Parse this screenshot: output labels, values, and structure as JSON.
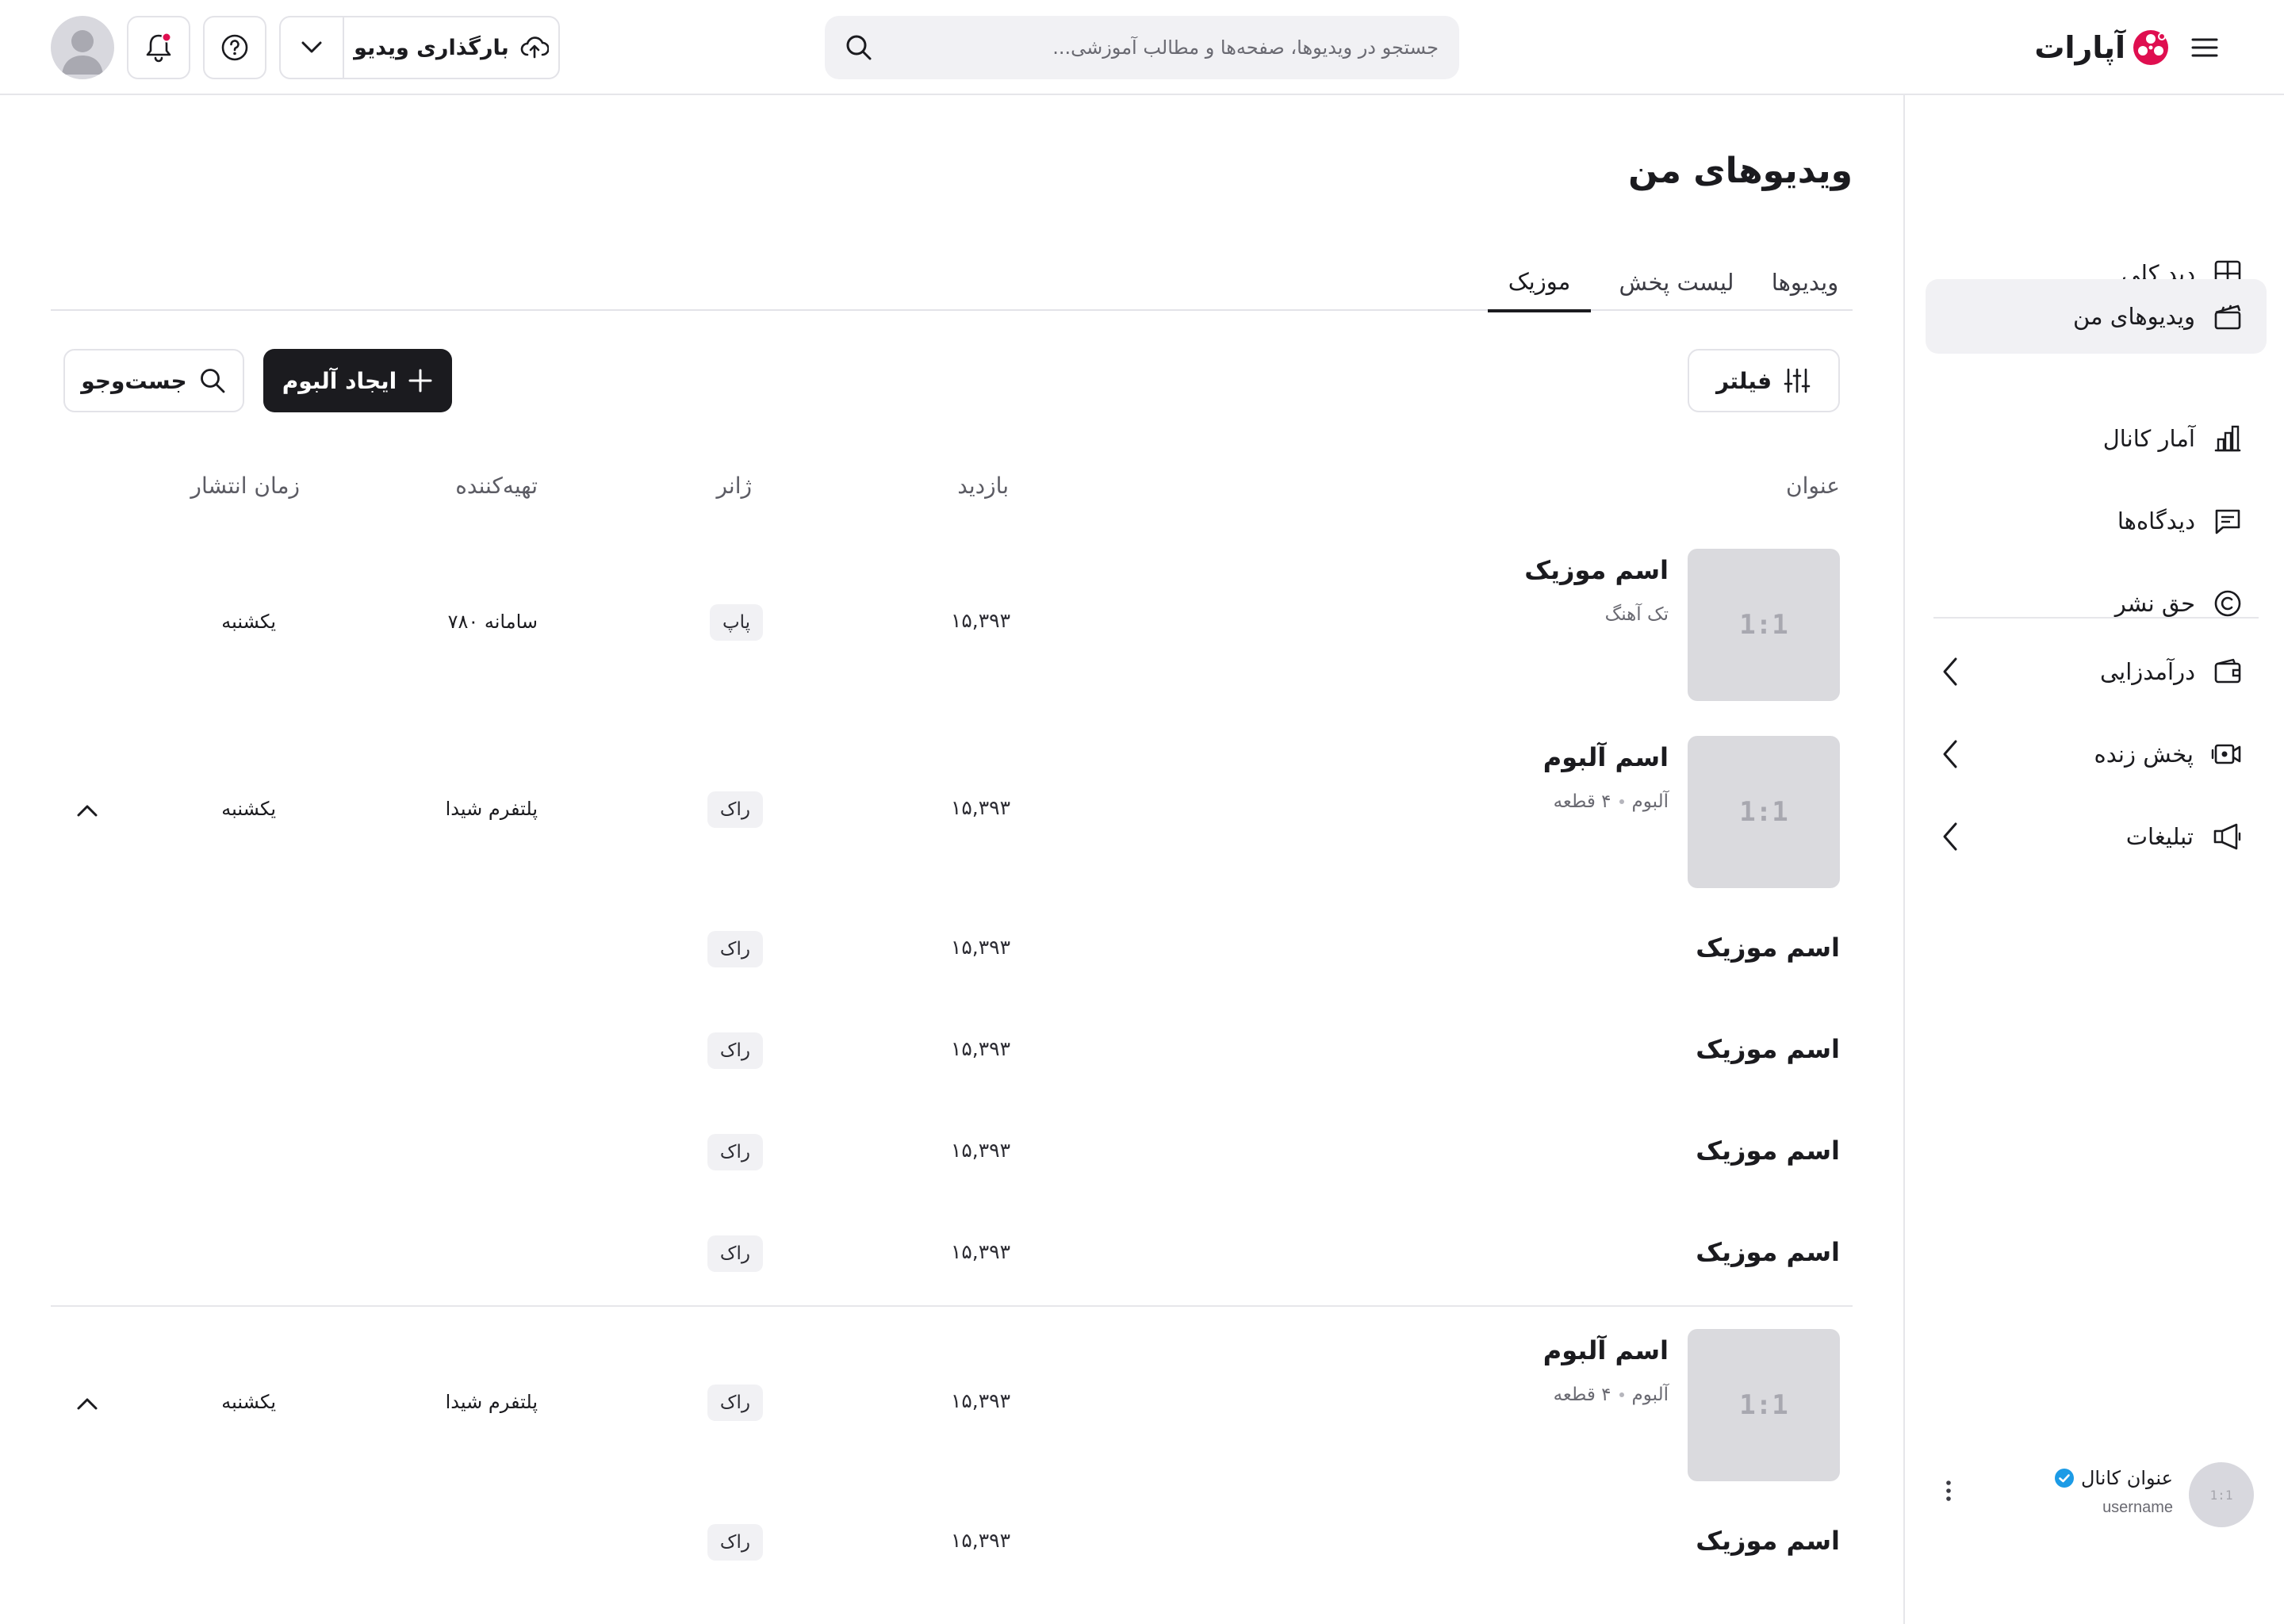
{
  "header": {
    "logo_text": "آپارات",
    "search_placeholder": "جستجو در ویدیوها، صفحه‌ها و مطالب آموزشی...",
    "upload_label": "بارگذاری ویدیو"
  },
  "sidebar": {
    "items": [
      {
        "label": "دید کلی",
        "icon": "grid-icon"
      },
      {
        "label": "ویدیوهای من",
        "icon": "clapperboard-icon",
        "active": true
      },
      {
        "label": "آمار کانال",
        "icon": "bar-chart-icon"
      },
      {
        "label": "دیدگاه‌ها",
        "icon": "comment-icon"
      },
      {
        "label": "حق نشر",
        "icon": "copyright-icon"
      },
      {
        "label": "درآمدزایی",
        "icon": "wallet-icon"
      },
      {
        "label": "پخش زنده",
        "icon": "live-icon"
      },
      {
        "label": "تبلیغات",
        "icon": "megaphone-icon"
      }
    ],
    "channel": {
      "title": "عنوان کانال",
      "username": "username",
      "avatar_text": "1:1"
    }
  },
  "main": {
    "title": "ویدیوهای من",
    "tabs": [
      "ویدیوها",
      "لیست پخش",
      "موزیک"
    ],
    "filter_label": "فیلتر",
    "create_album_label": "ایجاد آلبوم",
    "search_label": "جست‌وجو",
    "columns": [
      "عنوان",
      "بازدید",
      "ژانر",
      "تهیه‌کننده",
      "زمان انتشار"
    ],
    "thumb_text": "1:1",
    "rows": [
      {
        "title": "اسم موزیک",
        "subtitle": "تک آهنگ",
        "views": "۱۵,۳۹۳",
        "genre": "پاپ",
        "producer": "سامانه ۷۸۰",
        "date": "یکشنبه"
      },
      {
        "title": "اسم آلبوم",
        "subtitle_a": "آلبوم",
        "subtitle_b": "۴ قطعه",
        "views": "۱۵,۳۹۳",
        "genre": "راک",
        "producer": "پلتفرم شیدا",
        "date": "یکشنبه"
      },
      {
        "title": "اسم موزیک",
        "views": "۱۵,۳۹۳",
        "genre": "راک"
      },
      {
        "title": "اسم موزیک",
        "views": "۱۵,۳۹۳",
        "genre": "راک"
      },
      {
        "title": "اسم موزیک",
        "views": "۱۵,۳۹۳",
        "genre": "راک"
      },
      {
        "title": "اسم موزیک",
        "views": "۱۵,۳۹۳",
        "genre": "راک"
      },
      {
        "title": "اسم آلبوم",
        "subtitle_a": "آلبوم",
        "subtitle_b": "۴ قطعه",
        "views": "۱۵,۳۹۳",
        "genre": "راک",
        "producer": "پلتفرم شیدا",
        "date": "یکشنبه"
      },
      {
        "title": "اسم موزیک",
        "views": "۱۵,۳۹۳",
        "genre": "راک"
      }
    ]
  },
  "colors": {
    "brand": "#df0f50",
    "dark": "#1b1b1f",
    "verified": "#1c9be6"
  }
}
